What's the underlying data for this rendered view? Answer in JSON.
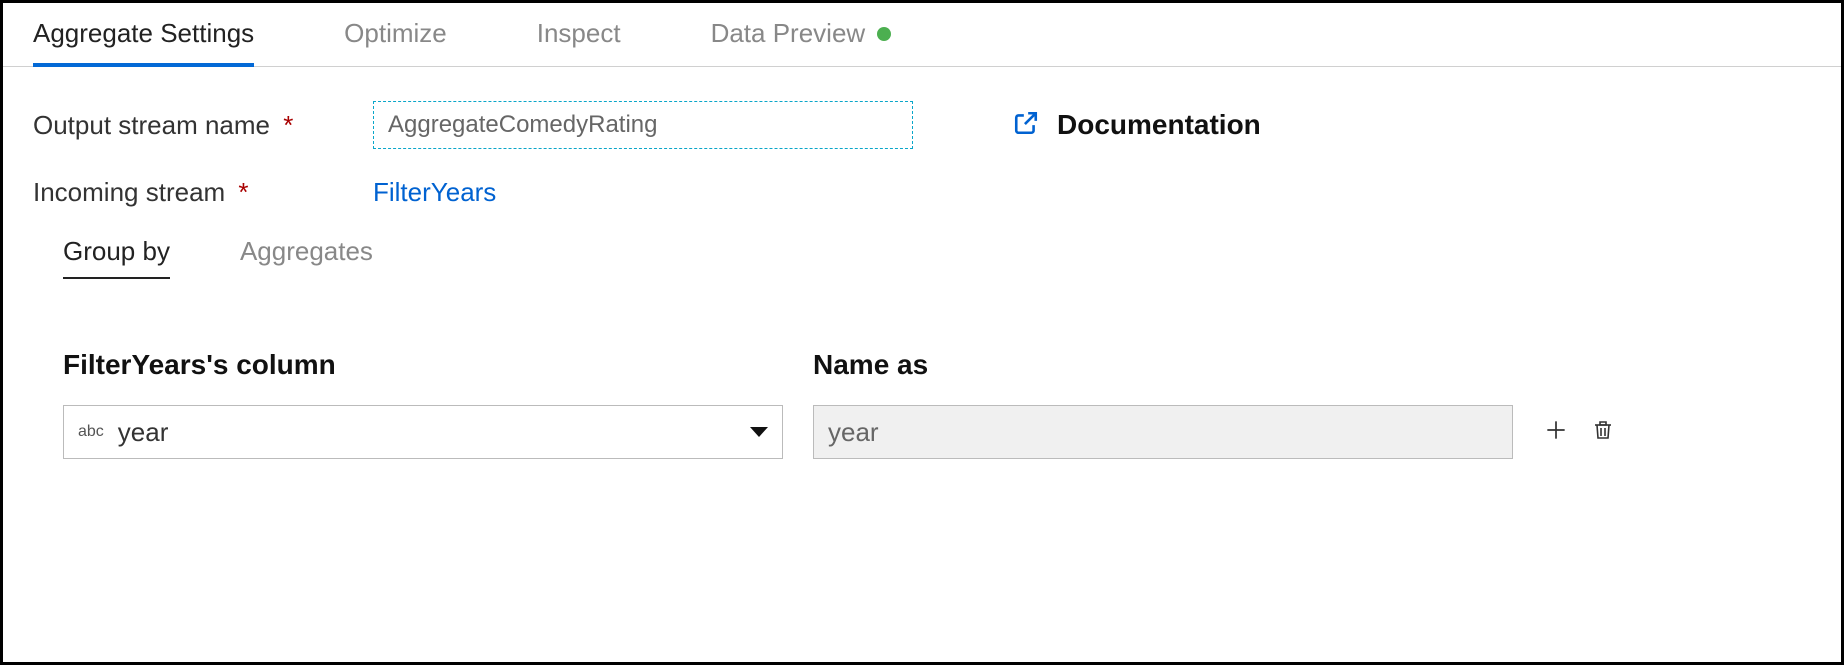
{
  "tabs": {
    "aggregate_settings": "Aggregate Settings",
    "optimize": "Optimize",
    "inspect": "Inspect",
    "data_preview": "Data Preview"
  },
  "form": {
    "output_stream_label": "Output stream name",
    "output_stream_value": "AggregateComedyRating",
    "incoming_stream_label": "Incoming stream",
    "incoming_stream_value": "FilterYears",
    "documentation": "Documentation"
  },
  "subtabs": {
    "group_by": "Group by",
    "aggregates": "Aggregates"
  },
  "columns": {
    "source_header": "FilterYears's column",
    "name_header": "Name as",
    "type_badge": "abc",
    "source_value": "year",
    "name_value": "year"
  }
}
